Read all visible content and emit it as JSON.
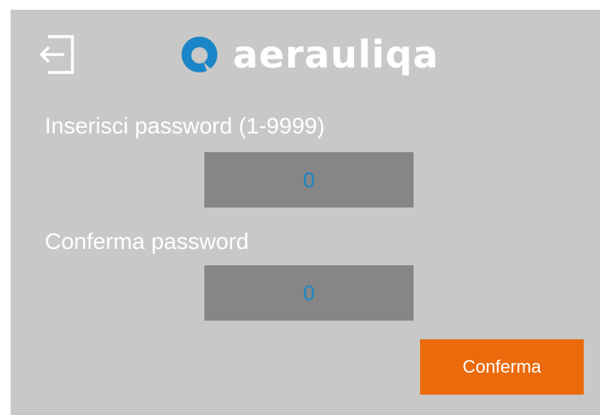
{
  "header": {
    "exit_icon": "exit-icon",
    "logo_text": "aerauliqa",
    "logo_icon": "aerauliqa-logo-icon"
  },
  "form": {
    "password_label": "Inserisci password (1-9999)",
    "password_value": "0",
    "confirm_label": "Conferma password",
    "confirm_value": "0"
  },
  "actions": {
    "confirm_button": "Conferma"
  },
  "colors": {
    "background": "#c8c8c6",
    "field": "#868686",
    "field_text": "#1a86c8",
    "accent": "#ea6a0c",
    "logo_blue": "#1a86c8"
  }
}
